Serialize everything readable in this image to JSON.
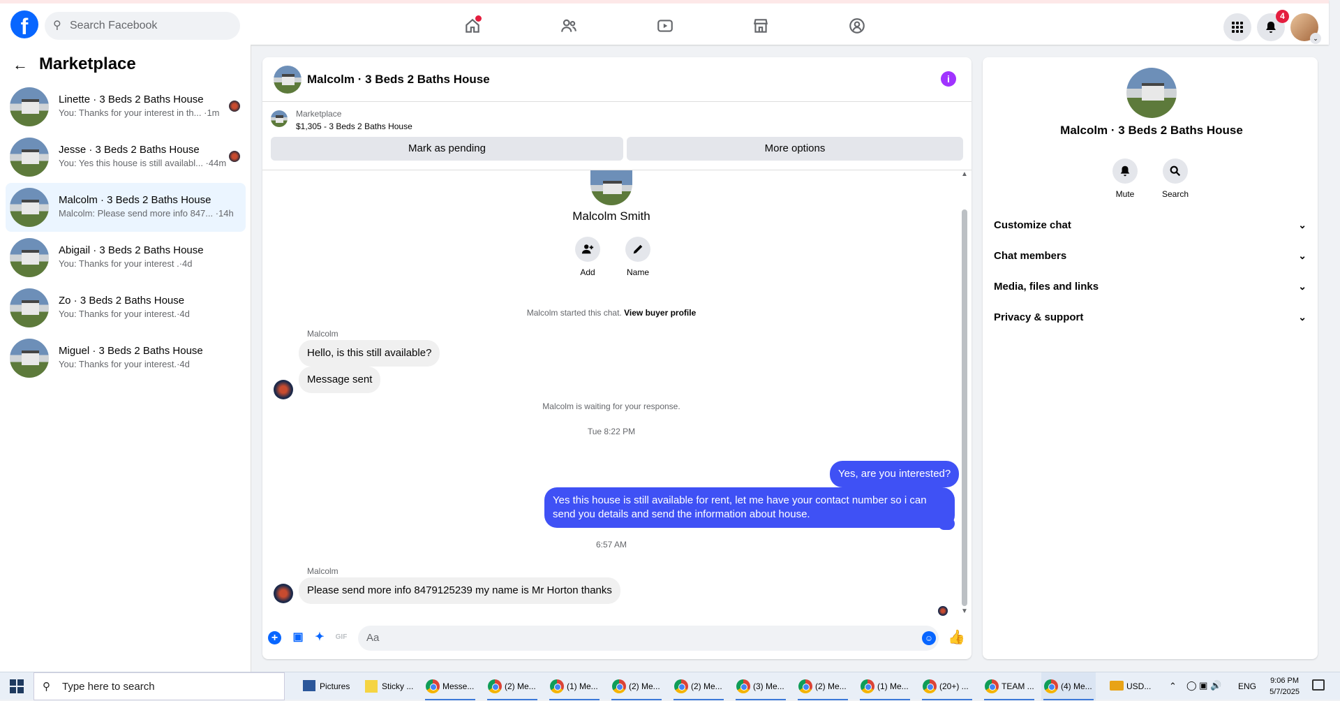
{
  "top": {
    "search_placeholder": "Search Facebook",
    "notification_count": "4"
  },
  "left": {
    "title": "Marketplace",
    "conversations": [
      {
        "title": "Linette · 3 Beds 2 Baths House",
        "snippet": "You: Thanks for your interest in th... ·1m"
      },
      {
        "title": "Jesse · 3 Beds 2 Baths House",
        "snippet": "You: Yes this house is still availabl... ·44m"
      },
      {
        "title": "Malcolm · 3 Beds 2 Baths House",
        "snippet": "Malcolm: Please send more info 847... ·14h"
      },
      {
        "title": "Abigail · 3 Beds 2 Baths House",
        "snippet": "You: Thanks for your interest .·4d"
      },
      {
        "title": "Zo · 3 Beds 2 Baths House",
        "snippet": "You: Thanks for your interest.·4d"
      },
      {
        "title": "Miguel · 3 Beds 2 Baths House",
        "snippet": "You: Thanks for your interest.·4d"
      }
    ]
  },
  "chat": {
    "header_title": "Malcolm · 3 Beds 2 Baths House",
    "listing_source": "Marketplace",
    "listing_title": "$1,305 - 3 Beds 2 Baths House",
    "mark_pending": "Mark as pending",
    "more_options": "More options",
    "contact_name": "Malcolm Smith",
    "add_label": "Add",
    "name_label": "Name",
    "started_text": "Malcolm started this chat.",
    "view_profile": "View buyer profile",
    "sender_name": "Malcolm",
    "msg1": "Hello, is this still available?",
    "msg2": "Message sent",
    "waiting": "Malcolm is waiting for your response.",
    "time1": "Tue 8:22 PM",
    "out1": "Yes, are you interested?",
    "out2": "Yes this house is still available for rent, let me have your contact number so i can send you details and send the information about house.",
    "time2": "6:57 AM",
    "msg3": "Please  send more info 8479125239 my name is Mr Horton thanks",
    "composer_placeholder": "Aa"
  },
  "right": {
    "title": "Malcolm · 3 Beds 2 Baths House",
    "mute": "Mute",
    "search": "Search",
    "sections": [
      "Customize chat",
      "Chat members",
      "Media, files and links",
      "Privacy & support"
    ]
  },
  "taskbar": {
    "search_placeholder": "Type here to search",
    "items": [
      "Pictures",
      "Sticky ...",
      "Messe...",
      "(2) Me...",
      "(1) Me...",
      "(2) Me...",
      "(2) Me...",
      "(3) Me...",
      "(2) Me...",
      "(1) Me...",
      "(20+) ...",
      "TEAM ...",
      "(4) Me..."
    ],
    "currency": "USD...",
    "lang": "ENG",
    "time": "9:06 PM",
    "date": "5/7/2025"
  },
  "colors": {
    "brand": "#0866ff",
    "outgoing_bubble": "#3f51f5",
    "info": "#a033ff"
  }
}
